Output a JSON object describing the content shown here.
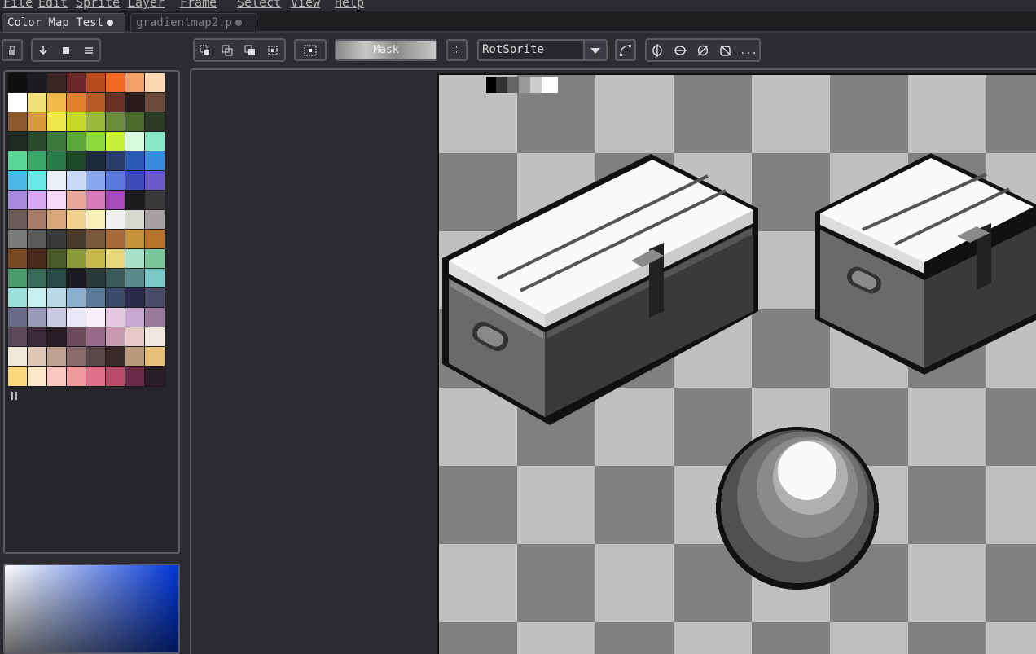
{
  "menu": [
    "File",
    "Edit",
    "Sprite",
    "Layer",
    "Frame",
    "Select",
    "View",
    "Help"
  ],
  "tabs": [
    {
      "label": "Color Map Test",
      "active": true
    },
    {
      "label": "gradientmap2.p",
      "active": false
    }
  ],
  "toolbar": {
    "mask_label": "Mask",
    "rotation_algorithm": "RotSprite",
    "more_label": "..."
  },
  "palette": {
    "colors": [
      "#0f0f12",
      "#1c1c22",
      "#3b2424",
      "#6b2727",
      "#b84a1e",
      "#ef6a20",
      "#f5a06a",
      "#fcd7b0",
      "#ffffff",
      "#f2e07a",
      "#f2b84a",
      "#e07f2c",
      "#b85a24",
      "#6b3024",
      "#2a1c1c",
      "#6b4a3a",
      "#8a5a2e",
      "#d89a3c",
      "#f0e84a",
      "#c8d82a",
      "#98b83a",
      "#6a8a3c",
      "#4a6a2c",
      "#2a3a24",
      "#1c2a22",
      "#2a4a2c",
      "#3a7a3c",
      "#5aa83c",
      "#8ad83a",
      "#c8f03a",
      "#d8fce0",
      "#8ae8c8",
      "#5ad89a",
      "#3aa86a",
      "#2a7a4a",
      "#1c4a2a",
      "#1c2a3a",
      "#2a3a6a",
      "#2a5ab8",
      "#3a8ae0",
      "#4ab8e8",
      "#6ae8e8",
      "#e8f0f8",
      "#c8d8f8",
      "#8aa8f0",
      "#5a7ae0",
      "#3a4ab8",
      "#6a5ac8",
      "#a88ae0",
      "#d8a8f0",
      "#f8d8f8",
      "#e8a898",
      "#d87ab8",
      "#a84ab8",
      "#1c1c1c",
      "#3a3a3a",
      "#6a5a5a",
      "#a87a6a",
      "#d8a87a",
      "#f0d08a",
      "#f8f0b8",
      "#f0f0f0",
      "#d8d8d0",
      "#a8a0a0",
      "#7a7a7a",
      "#5a5a5a",
      "#3a3a3a",
      "#4a3a2a",
      "#7a5a3a",
      "#a86a3a",
      "#c8923a",
      "#b8742e",
      "#7a4a24",
      "#4a2a1c",
      "#4a5a2a",
      "#8a9a3a",
      "#c8b84a",
      "#e8d87a",
      "#a8e0c8",
      "#7ac89a",
      "#4a9a6a",
      "#3a6a5a",
      "#2a4a4a",
      "#1c1c24",
      "#2a3a3a",
      "#3a5a5a",
      "#5a8a8a",
      "#7ac8c8",
      "#9ae0d8",
      "#c8f0f0",
      "#b8d8e8",
      "#8ab0d0",
      "#5a7a9a",
      "#3a4a6a",
      "#2a2a4a",
      "#4a4a6a",
      "#6a6a8a",
      "#9a9ab8",
      "#c8c8e0",
      "#e8e8f8",
      "#f8f0f8",
      "#e8c8e0",
      "#c8a8d0",
      "#9a7a9a",
      "#5a4a5a",
      "#3a2a3a",
      "#2a1c24",
      "#6a4a5a",
      "#9a6a8a",
      "#c89ab0",
      "#e8c8c8",
      "#f0e8e0",
      "#f0e8d8",
      "#e0c8b8",
      "#c0a090",
      "#8a6a6a",
      "#5a4a4a",
      "#3a2a2a",
      "#b89a7a",
      "#e8c07a",
      "#f8d87a",
      "#fce8c8",
      "#f8c8c0",
      "#f09aa0",
      "#e0708a",
      "#b84a6a",
      "#6a2a4a",
      "#2a1c24"
    ],
    "footer_icon": "pause-icon"
  }
}
